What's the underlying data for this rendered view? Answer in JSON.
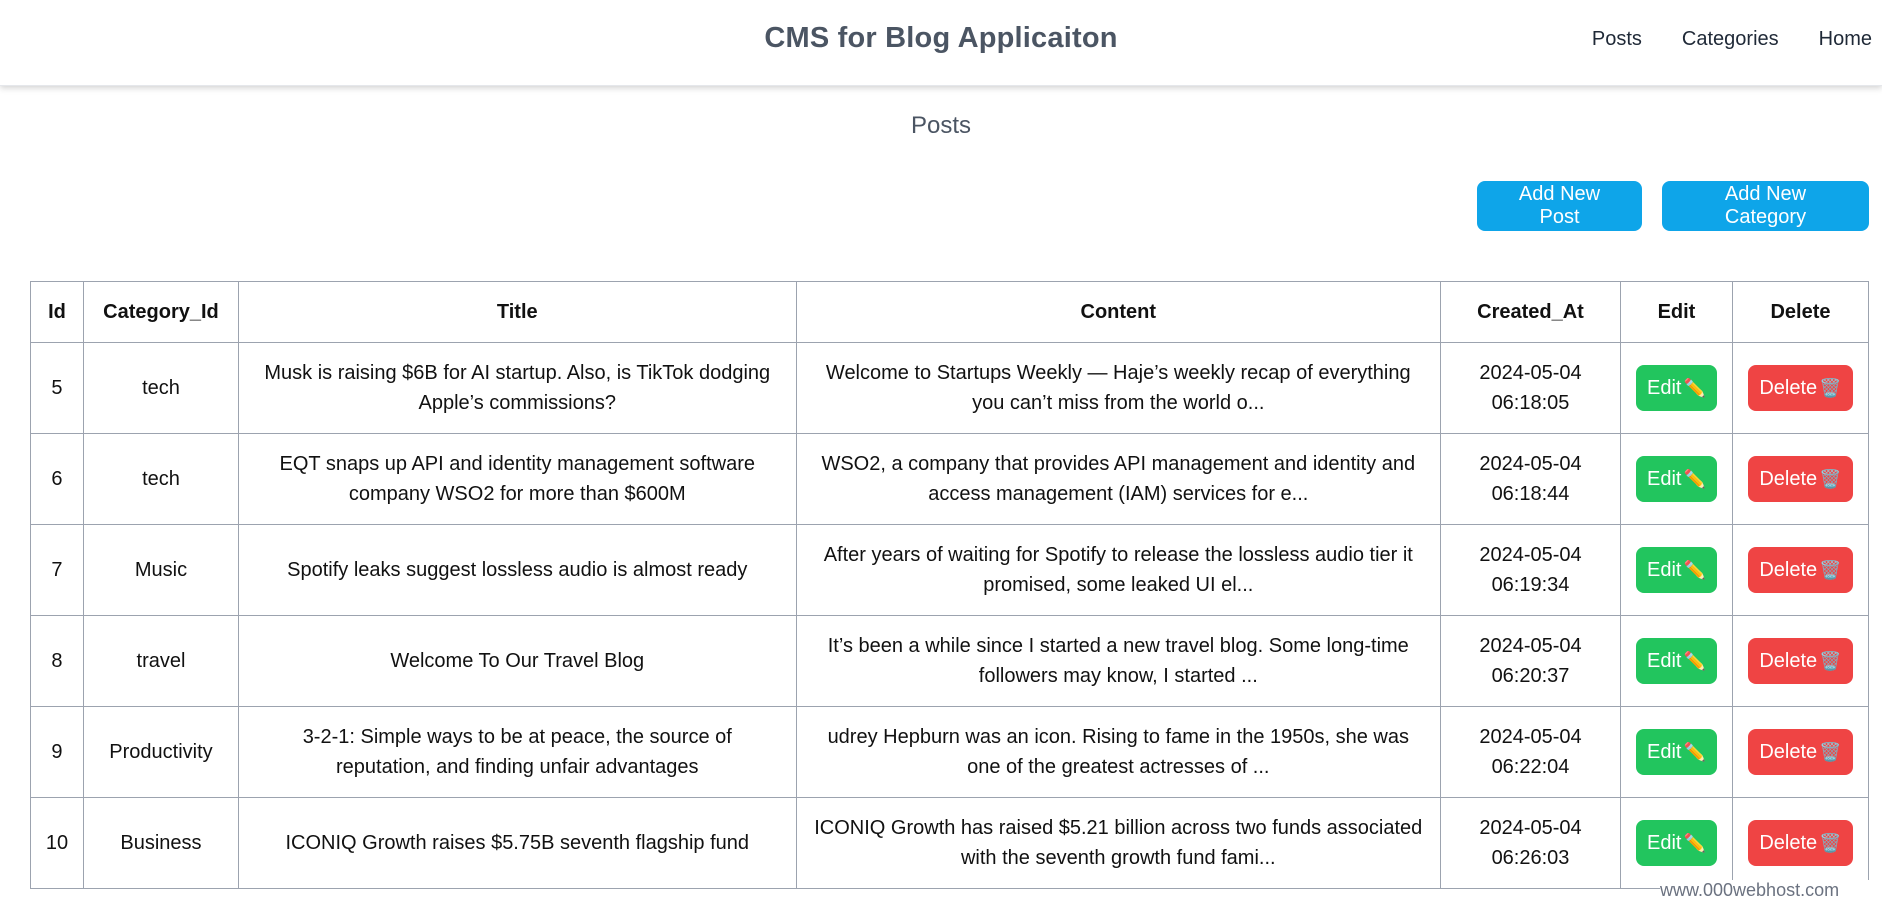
{
  "header": {
    "brand": "CMS for Blog Applicaiton",
    "nav": [
      {
        "label": "Posts"
      },
      {
        "label": "Categories"
      },
      {
        "label": "Home"
      }
    ]
  },
  "page": {
    "title": "Posts",
    "add_post_label": "Add New Post",
    "add_category_label": "Add New Category"
  },
  "table": {
    "columns": [
      "Id",
      "Category_Id",
      "Title",
      "Content",
      "Created_At",
      "Edit",
      "Delete"
    ],
    "rows": [
      {
        "id": "5",
        "category": "tech",
        "title": "Musk is raising $6B for AI startup. Also, is TikTok dodging Apple’s commissions?",
        "content": "Welcome to Startups Weekly — Haje’s weekly recap of everything you can’t miss from the world o...",
        "created": "2024-05-04 06:18:05"
      },
      {
        "id": "6",
        "category": "tech",
        "title": "EQT snaps up API and identity management software company WSO2 for more than $600M",
        "content": "WSO2, a company that provides API management and identity and access management (IAM) services for e...",
        "created": "2024-05-04 06:18:44"
      },
      {
        "id": "7",
        "category": "Music",
        "title": "Spotify leaks suggest lossless audio is almost ready",
        "content": "After years of waiting for Spotify to release the lossless audio tier it promised, some leaked UI el...",
        "created": "2024-05-04 06:19:34"
      },
      {
        "id": "8",
        "category": "travel",
        "title": "Welcome To Our Travel Blog",
        "content": "It’s been a while since I started a new travel blog. Some long-time followers may know, I started ...",
        "created": "2024-05-04 06:20:37"
      },
      {
        "id": "9",
        "category": "Productivity",
        "title": "3-2-1: Simple ways to be at peace, the source of reputation, and finding unfair advantages",
        "content": "udrey Hepburn was an icon. Rising to fame in the 1950s, she was one of the greatest actresses of ...",
        "created": "2024-05-04 06:22:04"
      },
      {
        "id": "10",
        "category": "Business",
        "title": "ICONIQ Growth raises $5.75B seventh flagship fund",
        "content": "ICONIQ Growth has raised $5.21 billion across two funds associated with the seventh growth fund fami...",
        "created": "2024-05-04 06:26:03"
      }
    ],
    "edit_label": "Edit",
    "delete_label": "Delete",
    "edit_icon": "pencil-icon",
    "delete_icon": "wastebasket-icon"
  },
  "footer": {
    "watermark": "www.000webhost.com"
  },
  "colors": {
    "primary_button": "#0ea5e9",
    "edit_button": "#22c55e",
    "delete_button": "#ef4444",
    "brand_text": "#4b5563"
  }
}
